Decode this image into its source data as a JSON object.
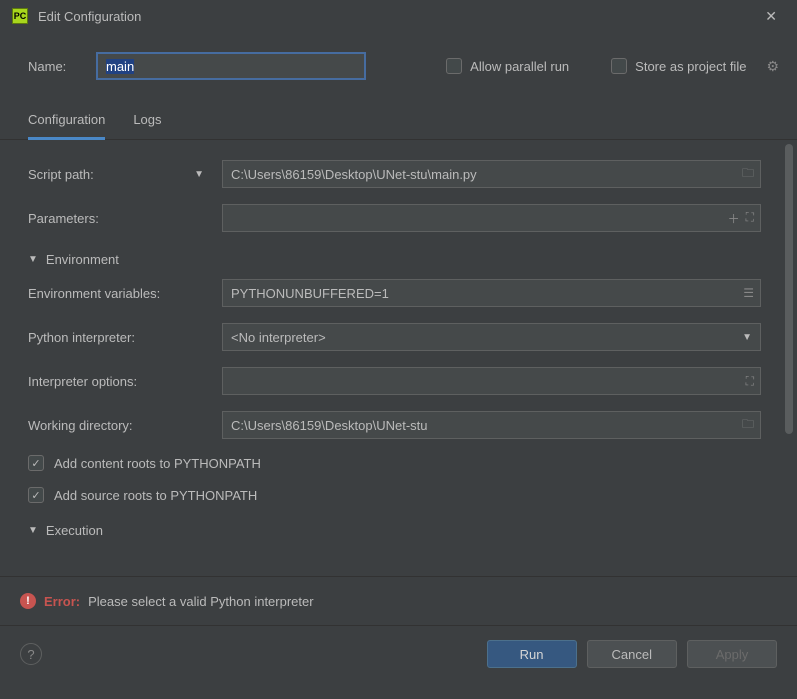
{
  "title": "Edit Configuration",
  "name_field": {
    "label": "Name:",
    "value": "main"
  },
  "options": {
    "allow_parallel": {
      "label": "Allow parallel run",
      "checked": false
    },
    "store_project": {
      "label": "Store as project file",
      "checked": false
    }
  },
  "tabs": {
    "configuration": "Configuration",
    "logs": "Logs"
  },
  "fields": {
    "script_path": {
      "label": "Script path:",
      "value": "C:\\Users\\86159\\Desktop\\UNet-stu\\main.py"
    },
    "parameters": {
      "label": "Parameters:",
      "value": ""
    },
    "env_section": "Environment",
    "env_vars": {
      "label": "Environment variables:",
      "value": "PYTHONUNBUFFERED=1"
    },
    "interpreter": {
      "label": "Python interpreter:",
      "value": "<No interpreter>"
    },
    "interp_options": {
      "label": "Interpreter options:",
      "value": ""
    },
    "working_dir": {
      "label": "Working directory:",
      "value": "C:\\Users\\86159\\Desktop\\UNet-stu"
    },
    "add_content_roots": {
      "label": "Add content roots to PYTHONPATH",
      "checked": true
    },
    "add_source_roots": {
      "label": "Add source roots to PYTHONPATH",
      "checked": true
    },
    "execution_section": "Execution"
  },
  "error": {
    "label": "Error:",
    "message": "Please select a valid Python interpreter"
  },
  "buttons": {
    "run": "Run",
    "cancel": "Cancel",
    "apply": "Apply"
  }
}
